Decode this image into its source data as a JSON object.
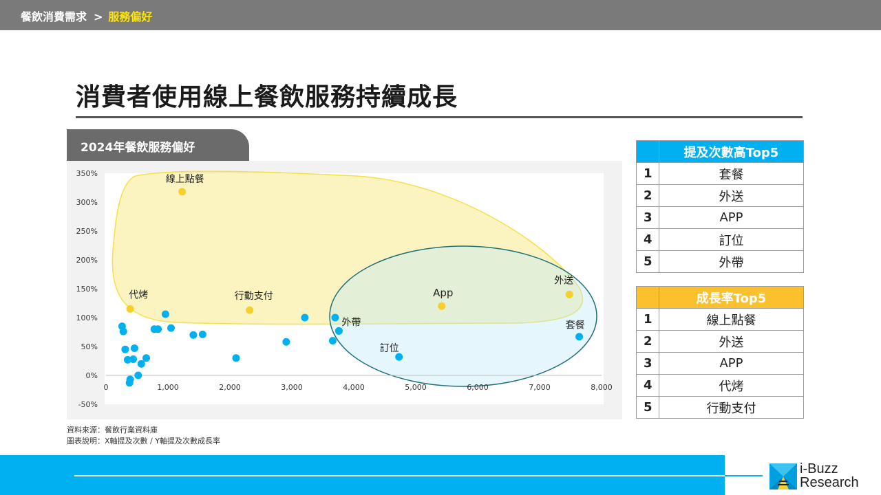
{
  "breadcrumb": {
    "parent": "餐飲消費需求",
    "separator": ">",
    "current": "服務偏好"
  },
  "page_title": "消費者使用線上餐飲服務持續成長",
  "chart_tab_label": "2024年餐飲服務偏好",
  "colors": {
    "topbar": "#7a7a7a",
    "highlight_text": "#ffe600",
    "point": "#00b0f0",
    "highlight_point": "#f5d02c",
    "yellow_region": "#f5e04a",
    "teal_region": "#1f6f78",
    "table1_header": "#00b0f0",
    "table2_header": "#fbc02d",
    "footer": "#00b0f0"
  },
  "chart_data": {
    "type": "scatter",
    "title": "",
    "xlabel": "",
    "ylabel": "",
    "xlim": [
      0,
      8000
    ],
    "ylim": [
      -50,
      350
    ],
    "x_ticks": [
      0,
      1000,
      2000,
      3000,
      4000,
      5000,
      6000,
      7000,
      8000
    ],
    "x_tick_labels": [
      "0",
      "1,000",
      "2,000",
      "3,000",
      "4,000",
      "5,000",
      "6,000",
      "7,000",
      "8,000"
    ],
    "y_ticks": [
      -50,
      0,
      50,
      100,
      150,
      200,
      250,
      300,
      350
    ],
    "y_tick_labels": [
      "-50%",
      "0%",
      "50%",
      "100%",
      "150%",
      "200%",
      "250%",
      "300%",
      "350%"
    ],
    "grid": false,
    "points": [
      {
        "x": 1230,
        "y": 318,
        "label": "線上點餐",
        "highlight": true
      },
      {
        "x": 390,
        "y": 115,
        "label": "代烤",
        "highlight": true
      },
      {
        "x": 2320,
        "y": 113,
        "label": "行動支付",
        "highlight": true
      },
      {
        "x": 5420,
        "y": 120,
        "label": "App",
        "highlight": true
      },
      {
        "x": 7480,
        "y": 140,
        "label": "外送",
        "highlight": true
      },
      {
        "x": 7640,
        "y": 67,
        "label": "套餐",
        "highlight": false
      },
      {
        "x": 3760,
        "y": 77,
        "label": "外帶",
        "highlight": false
      },
      {
        "x": 4730,
        "y": 32,
        "label": "訂位",
        "highlight": false
      },
      {
        "x": 3700,
        "y": 100,
        "label": "",
        "highlight": false
      },
      {
        "x": 3210,
        "y": 100,
        "label": "",
        "highlight": false
      },
      {
        "x": 3660,
        "y": 60,
        "label": "",
        "highlight": false
      },
      {
        "x": 2910,
        "y": 58,
        "label": "",
        "highlight": false
      },
      {
        "x": 2100,
        "y": 30,
        "label": "",
        "highlight": false
      },
      {
        "x": 960,
        "y": 106,
        "label": "",
        "highlight": false
      },
      {
        "x": 1050,
        "y": 82,
        "label": "",
        "highlight": false
      },
      {
        "x": 840,
        "y": 80,
        "label": "",
        "highlight": false
      },
      {
        "x": 780,
        "y": 80,
        "label": "",
        "highlight": false
      },
      {
        "x": 1410,
        "y": 70,
        "label": "",
        "highlight": false
      },
      {
        "x": 1560,
        "y": 71,
        "label": "",
        "highlight": false
      },
      {
        "x": 260,
        "y": 85,
        "label": "",
        "highlight": false
      },
      {
        "x": 280,
        "y": 76,
        "label": "",
        "highlight": false
      },
      {
        "x": 310,
        "y": 45,
        "label": "",
        "highlight": false
      },
      {
        "x": 460,
        "y": 47,
        "label": "",
        "highlight": false
      },
      {
        "x": 350,
        "y": 27,
        "label": "",
        "highlight": false
      },
      {
        "x": 440,
        "y": 28,
        "label": "",
        "highlight": false
      },
      {
        "x": 650,
        "y": 30,
        "label": "",
        "highlight": false
      },
      {
        "x": 570,
        "y": 20,
        "label": "",
        "highlight": false
      },
      {
        "x": 520,
        "y": 0,
        "label": "",
        "highlight": false
      },
      {
        "x": 390,
        "y": -7,
        "label": "",
        "highlight": false
      },
      {
        "x": 380,
        "y": -13,
        "label": "",
        "highlight": false
      }
    ]
  },
  "table_mentions": {
    "header": "提及次數高Top5",
    "rows": [
      {
        "rank": "1",
        "item": "套餐"
      },
      {
        "rank": "2",
        "item": "外送"
      },
      {
        "rank": "3",
        "item": "APP"
      },
      {
        "rank": "4",
        "item": "訂位"
      },
      {
        "rank": "5",
        "item": "外帶"
      }
    ]
  },
  "table_growth": {
    "header": "成長率Top5",
    "rows": [
      {
        "rank": "1",
        "item": "線上點餐"
      },
      {
        "rank": "2",
        "item": "外送"
      },
      {
        "rank": "3",
        "item": "APP"
      },
      {
        "rank": "4",
        "item": "代烤"
      },
      {
        "rank": "5",
        "item": "行動支付"
      }
    ]
  },
  "footnotes": {
    "source": "資料來源：餐飲行業資料庫",
    "note": "圖表說明：X軸提及次數 / Y軸提及次數成長率"
  },
  "logo": {
    "line1": "i-Buzz",
    "line2": "Research"
  }
}
